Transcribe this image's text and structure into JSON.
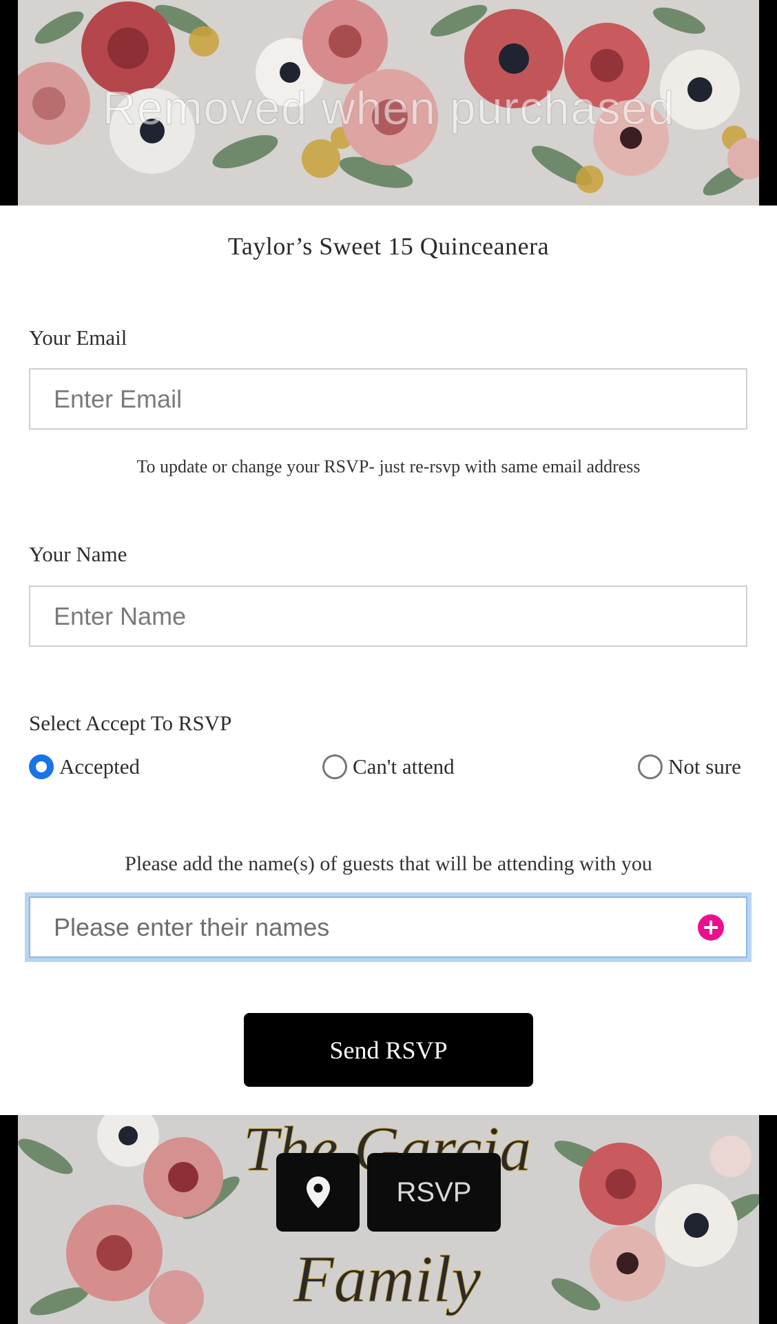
{
  "banner": {
    "watermark": "Removed when purchased"
  },
  "title": "Taylor’s Sweet 15 Quinceanera",
  "email": {
    "label": "Your Email",
    "placeholder": "Enter Email",
    "hint": "To update or change your RSVP- just re-rsvp with same email address"
  },
  "name": {
    "label": "Your Name",
    "placeholder": "Enter Name"
  },
  "rsvp": {
    "label": "Select Accept To RSVP",
    "options": [
      "Accepted",
      "Can't attend",
      "Not sure"
    ],
    "selected": "Accepted"
  },
  "guests": {
    "prompt": "Please add the name(s) of guests that will be attending with you",
    "placeholder": "Please enter their names",
    "add_icon": "plus-circle-icon"
  },
  "submit_label": "Send RSVP",
  "footer": {
    "family_text": "The Garcia Family",
    "location_icon": "map-pin-icon",
    "rsvp_label": "RSVP"
  },
  "colors": {
    "accent_blue": "#1a73e8",
    "add_pink": "#ec0e8c",
    "button_black": "#000000"
  }
}
